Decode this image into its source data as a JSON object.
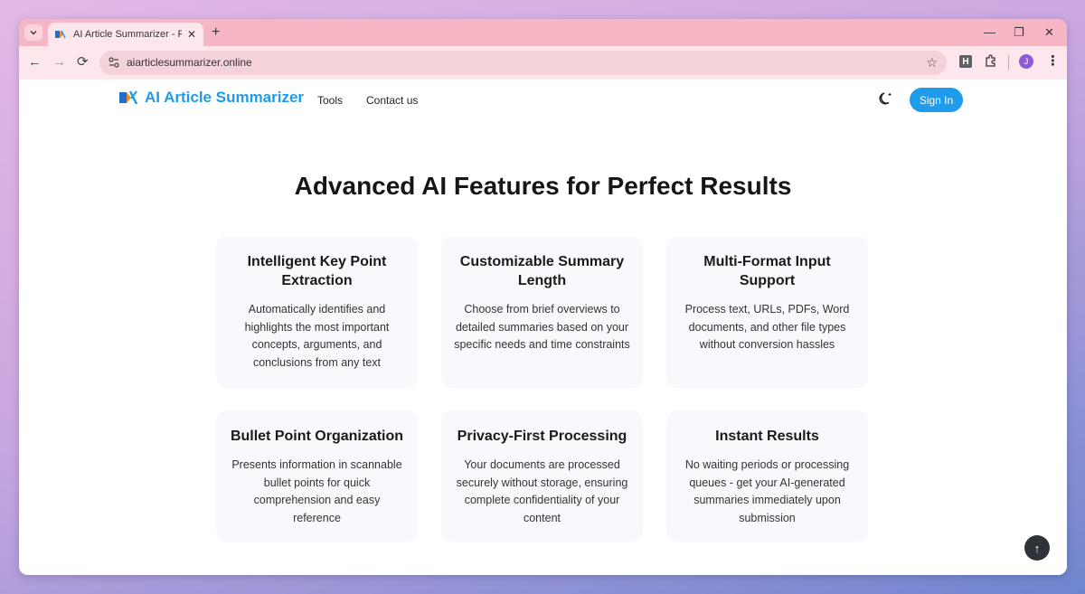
{
  "browser": {
    "tab_title": "AI Article Summarizer - Free Te:",
    "tab_close": "✕",
    "new_tab": "+",
    "menu_icon": "chevron-down",
    "url": "aiarticlesummarizer.online",
    "back": "←",
    "forward": "→",
    "reload": "⟳",
    "star": "☆",
    "ext_h": "H",
    "profile_initial": "J",
    "more": "⋮",
    "minimize": "—",
    "restore": "❐",
    "close": "✕"
  },
  "site": {
    "brand": "AI Article Summarizer",
    "nav": [
      "Tools",
      "Contact us"
    ],
    "sign_in": "Sign In",
    "accent": "#1e9bea"
  },
  "section": {
    "title": "Advanced AI Features for Perfect Results",
    "features": [
      {
        "title": "Intelligent Key Point Extraction",
        "text": "Automatically identifies and highlights the most important concepts, arguments, and conclusions from any text"
      },
      {
        "title": "Customizable Summary Length",
        "text": "Choose from brief overviews to detailed summaries based on your specific needs and time constraints"
      },
      {
        "title": "Multi-Format Input Support",
        "text": "Process text, URLs, PDFs, Word documents, and other file types without conversion hassles"
      },
      {
        "title": "Bullet Point Organization",
        "text": "Presents information in scannable bullet points for quick comprehension and easy reference"
      },
      {
        "title": "Privacy-First Processing",
        "text": "Your documents are processed securely without storage, ensuring complete confidentiality of your content"
      },
      {
        "title": "Instant Results",
        "text": "No waiting periods or processing queues - get your AI-generated summaries immediately upon submission"
      }
    ]
  },
  "scroll_top": "↑"
}
